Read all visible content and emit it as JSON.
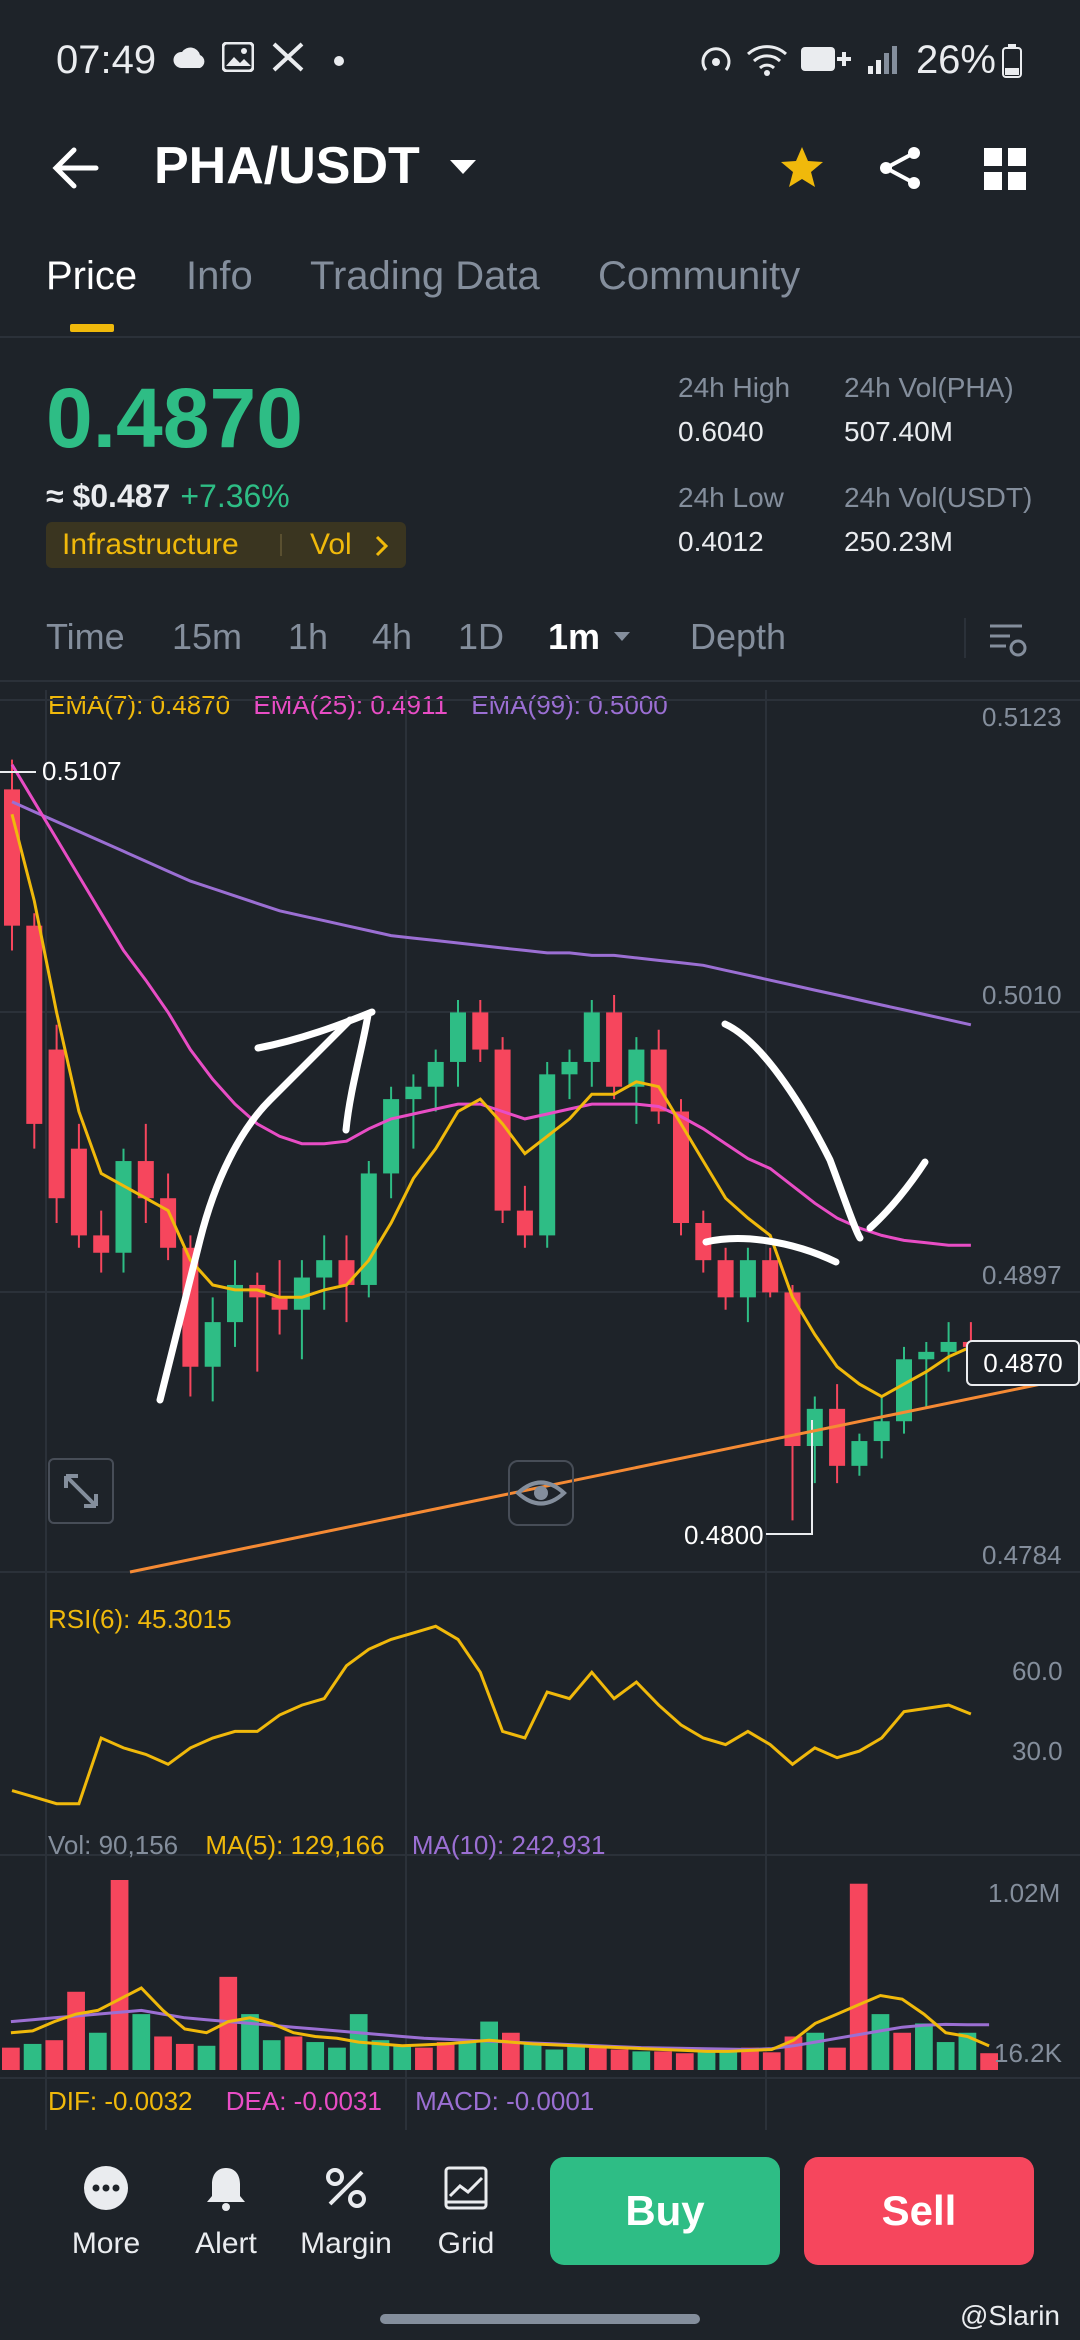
{
  "status": {
    "time": "07:49",
    "battery": "26%"
  },
  "header": {
    "pair": "PHA/USDT"
  },
  "tabs": [
    {
      "label": "Price",
      "active": true
    },
    {
      "label": "Info",
      "active": false
    },
    {
      "label": "Trading Data",
      "active": false
    },
    {
      "label": "Community",
      "active": false
    }
  ],
  "summary": {
    "last_price": "0.4870",
    "fiat_price": "≈ $0.487",
    "change": "+7.36%",
    "tag": "Infrastructure",
    "tag_vol": "Vol",
    "high_label": "24h High",
    "high_value": "0.6040",
    "low_label": "24h Low",
    "low_value": "0.4012",
    "vol_base_label": "24h Vol(PHA)",
    "vol_base_value": "507.40M",
    "vol_quote_label": "24h Vol(USDT)",
    "vol_quote_value": "250.23M"
  },
  "timeframes": [
    "Time",
    "15m",
    "1h",
    "4h",
    "1D",
    "1m",
    "Depth"
  ],
  "chart_labels": {
    "ema7": "EMA(7): 0.4870",
    "ema25": "EMA(25): 0.4911",
    "ema99": "EMA(99): 0.5000",
    "y_ticks": [
      "0.5123",
      "0.5010",
      "0.4897",
      "0.4784"
    ],
    "high_marker": "0.5107",
    "low_marker": "0.4800",
    "current_price": "0.4870",
    "rsi": "RSI(6): 45.3015",
    "rsi_ticks": [
      "60.0",
      "30.0"
    ],
    "vol": "Vol: 90,156",
    "ma5": "MA(5): 129,166",
    "ma10": "MA(10): 242,931",
    "vol_ticks": [
      "1.02M",
      "16.2K"
    ],
    "dif": "DIF: -0.0032",
    "dea": "DEA: -0.0031",
    "macd": "MACD: -0.0001"
  },
  "nav": [
    {
      "label": "More",
      "icon": "more-icon"
    },
    {
      "label": "Alert",
      "icon": "bell-icon"
    },
    {
      "label": "Margin",
      "icon": "margin-icon"
    },
    {
      "label": "Grid",
      "icon": "grid-icon"
    }
  ],
  "buttons": {
    "buy": "Buy",
    "sell": "Sell"
  },
  "watermark": "@Slarin",
  "colors": {
    "up": "#2ebd85",
    "down": "#f6465d",
    "accent": "#f0b90b",
    "ema25": "#e84dc5",
    "ema99": "#9b6fd3"
  },
  "chart_data": [
    {
      "type": "candlestick",
      "ylim": [
        0.4784,
        0.5123
      ],
      "candles": [
        {
          "o": 0.5095,
          "h": 0.5107,
          "l": 0.503,
          "c": 0.504
        },
        {
          "o": 0.504,
          "h": 0.5045,
          "l": 0.495,
          "c": 0.496
        },
        {
          "o": 0.499,
          "h": 0.5,
          "l": 0.492,
          "c": 0.493
        },
        {
          "o": 0.495,
          "h": 0.496,
          "l": 0.491,
          "c": 0.4915
        },
        {
          "o": 0.4915,
          "h": 0.4925,
          "l": 0.49,
          "c": 0.4908
        },
        {
          "o": 0.4908,
          "h": 0.495,
          "l": 0.49,
          "c": 0.4945
        },
        {
          "o": 0.4945,
          "h": 0.496,
          "l": 0.492,
          "c": 0.493
        },
        {
          "o": 0.493,
          "h": 0.494,
          "l": 0.4905,
          "c": 0.491
        },
        {
          "o": 0.491,
          "h": 0.4915,
          "l": 0.485,
          "c": 0.4862
        },
        {
          "o": 0.4862,
          "h": 0.489,
          "l": 0.4848,
          "c": 0.488
        },
        {
          "o": 0.488,
          "h": 0.4905,
          "l": 0.487,
          "c": 0.4895
        },
        {
          "o": 0.4895,
          "h": 0.49,
          "l": 0.486,
          "c": 0.489
        },
        {
          "o": 0.489,
          "h": 0.4905,
          "l": 0.4875,
          "c": 0.4885
        },
        {
          "o": 0.4885,
          "h": 0.4905,
          "l": 0.4865,
          "c": 0.4898
        },
        {
          "o": 0.4898,
          "h": 0.4915,
          "l": 0.4885,
          "c": 0.4905
        },
        {
          "o": 0.4905,
          "h": 0.4915,
          "l": 0.488,
          "c": 0.4895
        },
        {
          "o": 0.4895,
          "h": 0.4945,
          "l": 0.489,
          "c": 0.494
        },
        {
          "o": 0.494,
          "h": 0.4975,
          "l": 0.493,
          "c": 0.497
        },
        {
          "o": 0.497,
          "h": 0.498,
          "l": 0.495,
          "c": 0.4975
        },
        {
          "o": 0.4975,
          "h": 0.499,
          "l": 0.4965,
          "c": 0.4985
        },
        {
          "o": 0.4985,
          "h": 0.501,
          "l": 0.4975,
          "c": 0.5005
        },
        {
          "o": 0.5005,
          "h": 0.501,
          "l": 0.4985,
          "c": 0.499
        },
        {
          "o": 0.499,
          "h": 0.4995,
          "l": 0.492,
          "c": 0.4925
        },
        {
          "o": 0.4925,
          "h": 0.4935,
          "l": 0.491,
          "c": 0.4915
        },
        {
          "o": 0.4915,
          "h": 0.4985,
          "l": 0.491,
          "c": 0.498
        },
        {
          "o": 0.498,
          "h": 0.499,
          "l": 0.497,
          "c": 0.4985
        },
        {
          "o": 0.4985,
          "h": 0.501,
          "l": 0.4975,
          "c": 0.5005
        },
        {
          "o": 0.5005,
          "h": 0.5012,
          "l": 0.497,
          "c": 0.4975
        },
        {
          "o": 0.4975,
          "h": 0.4995,
          "l": 0.496,
          "c": 0.499
        },
        {
          "o": 0.499,
          "h": 0.4998,
          "l": 0.496,
          "c": 0.4965
        },
        {
          "o": 0.4965,
          "h": 0.497,
          "l": 0.4915,
          "c": 0.492
        },
        {
          "o": 0.492,
          "h": 0.4925,
          "l": 0.49,
          "c": 0.4905
        },
        {
          "o": 0.4905,
          "h": 0.491,
          "l": 0.4885,
          "c": 0.489
        },
        {
          "o": 0.489,
          "h": 0.491,
          "l": 0.488,
          "c": 0.4905
        },
        {
          "o": 0.4905,
          "h": 0.491,
          "l": 0.489,
          "c": 0.4892
        },
        {
          "o": 0.4892,
          "h": 0.4895,
          "l": 0.48,
          "c": 0.483
        },
        {
          "o": 0.483,
          "h": 0.485,
          "l": 0.4815,
          "c": 0.4845
        },
        {
          "o": 0.4845,
          "h": 0.4855,
          "l": 0.4815,
          "c": 0.4822
        },
        {
          "o": 0.4822,
          "h": 0.4835,
          "l": 0.4818,
          "c": 0.4832
        },
        {
          "o": 0.4832,
          "h": 0.485,
          "l": 0.4825,
          "c": 0.484
        },
        {
          "o": 0.484,
          "h": 0.487,
          "l": 0.4835,
          "c": 0.4865
        },
        {
          "o": 0.4865,
          "h": 0.4872,
          "l": 0.4845,
          "c": 0.4868
        },
        {
          "o": 0.4868,
          "h": 0.488,
          "l": 0.486,
          "c": 0.4872
        },
        {
          "o": 0.4872,
          "h": 0.488,
          "l": 0.4865,
          "c": 0.487
        }
      ],
      "ema7": [
        0.5085,
        0.505,
        0.5005,
        0.4965,
        0.494,
        0.4935,
        0.493,
        0.4925,
        0.4905,
        0.4895,
        0.4893,
        0.4893,
        0.489,
        0.489,
        0.4893,
        0.4895,
        0.4905,
        0.492,
        0.4938,
        0.495,
        0.4965,
        0.497,
        0.496,
        0.4948,
        0.4955,
        0.4962,
        0.4972,
        0.4972,
        0.4977,
        0.4975,
        0.496,
        0.4945,
        0.493,
        0.4922,
        0.4915,
        0.489,
        0.4875,
        0.4862,
        0.4855,
        0.485,
        0.4855,
        0.486,
        0.4866,
        0.487
      ],
      "ema25": [
        0.5105,
        0.509,
        0.5075,
        0.506,
        0.5045,
        0.503,
        0.5018,
        0.5005,
        0.499,
        0.4978,
        0.4968,
        0.496,
        0.4955,
        0.4952,
        0.4952,
        0.4953,
        0.4958,
        0.4962,
        0.4964,
        0.4966,
        0.4968,
        0.4968,
        0.4965,
        0.4962,
        0.4964,
        0.4966,
        0.4968,
        0.4968,
        0.4968,
        0.4967,
        0.4963,
        0.4958,
        0.4952,
        0.4946,
        0.4942,
        0.4935,
        0.4928,
        0.4922,
        0.4918,
        0.4915,
        0.4913,
        0.4912,
        0.4911,
        0.4911
      ],
      "ema99": [
        0.509,
        0.5086,
        0.5082,
        0.5078,
        0.5074,
        0.507,
        0.5066,
        0.5062,
        0.5058,
        0.5055,
        0.5052,
        0.5049,
        0.5046,
        0.5044,
        0.5042,
        0.504,
        0.5038,
        0.5036,
        0.5035,
        0.5034,
        0.5033,
        0.5032,
        0.5031,
        0.503,
        0.5029,
        0.5029,
        0.5028,
        0.5028,
        0.5027,
        0.5026,
        0.5025,
        0.5024,
        0.5022,
        0.502,
        0.5018,
        0.5016,
        0.5014,
        0.5012,
        0.501,
        0.5008,
        0.5006,
        0.5004,
        0.5002,
        0.5
      ]
    },
    {
      "type": "line",
      "name": "RSI(6)",
      "ylim": [
        10,
        80
      ],
      "values": [
        22,
        20,
        18,
        18,
        38,
        35,
        33,
        30,
        35,
        38,
        40,
        40,
        45,
        48,
        50,
        60,
        65,
        68,
        70,
        72,
        68,
        58,
        40,
        38,
        52,
        50,
        58,
        50,
        55,
        48,
        42,
        38,
        36,
        40,
        36,
        30,
        35,
        32,
        34,
        38,
        46,
        47,
        48,
        45.3
      ]
    },
    {
      "type": "bar",
      "name": "Volume",
      "ylim": [
        0,
        1020000
      ],
      "values": [
        120000,
        140000,
        160000,
        420000,
        200000,
        1020000,
        300000,
        180000,
        140000,
        130000,
        500000,
        300000,
        160000,
        180000,
        150000,
        120000,
        300000,
        160000,
        130000,
        120000,
        150000,
        160000,
        260000,
        200000,
        150000,
        110000,
        130000,
        120000,
        110000,
        100000,
        100000,
        90000,
        110000,
        100000,
        120000,
        95000,
        180000,
        200000,
        120000,
        1000000,
        300000,
        200000,
        250000,
        150000,
        200000,
        90156
      ],
      "up": [
        false,
        true,
        false,
        false,
        true,
        false,
        true,
        false,
        false,
        true,
        false,
        true,
        true,
        false,
        true,
        true,
        true,
        true,
        true,
        false,
        false,
        true,
        true,
        false,
        true,
        true,
        true,
        false,
        false,
        true,
        false,
        false,
        true,
        true,
        false,
        false,
        false,
        true,
        false,
        false,
        true,
        false,
        true,
        true,
        true,
        false
      ],
      "ma5": [
        200000,
        210000,
        260000,
        300000,
        320000,
        380000,
        440000,
        320000,
        220000,
        200000,
        260000,
        280000,
        250000,
        200000,
        180000,
        170000,
        150000,
        140000,
        130000,
        135000,
        140000,
        150000,
        160000,
        150000,
        140000,
        135000,
        130000,
        125000,
        120000,
        115000,
        110000,
        105000,
        100000,
        100000,
        105000,
        110000,
        160000,
        250000,
        300000,
        350000,
        400000,
        380000,
        300000,
        200000,
        180000,
        129166
      ],
      "ma10": [
        260000,
        270000,
        280000,
        290000,
        300000,
        310000,
        320000,
        300000,
        280000,
        270000,
        260000,
        250000,
        240000,
        230000,
        220000,
        210000,
        200000,
        190000,
        180000,
        170000,
        165000,
        160000,
        155000,
        150000,
        145000,
        140000,
        135000,
        130000,
        125000,
        120000,
        118000,
        116000,
        114000,
        112000,
        110000,
        115000,
        130000,
        150000,
        170000,
        190000,
        210000,
        230000,
        240000,
        245000,
        243000,
        242931
      ]
    }
  ]
}
